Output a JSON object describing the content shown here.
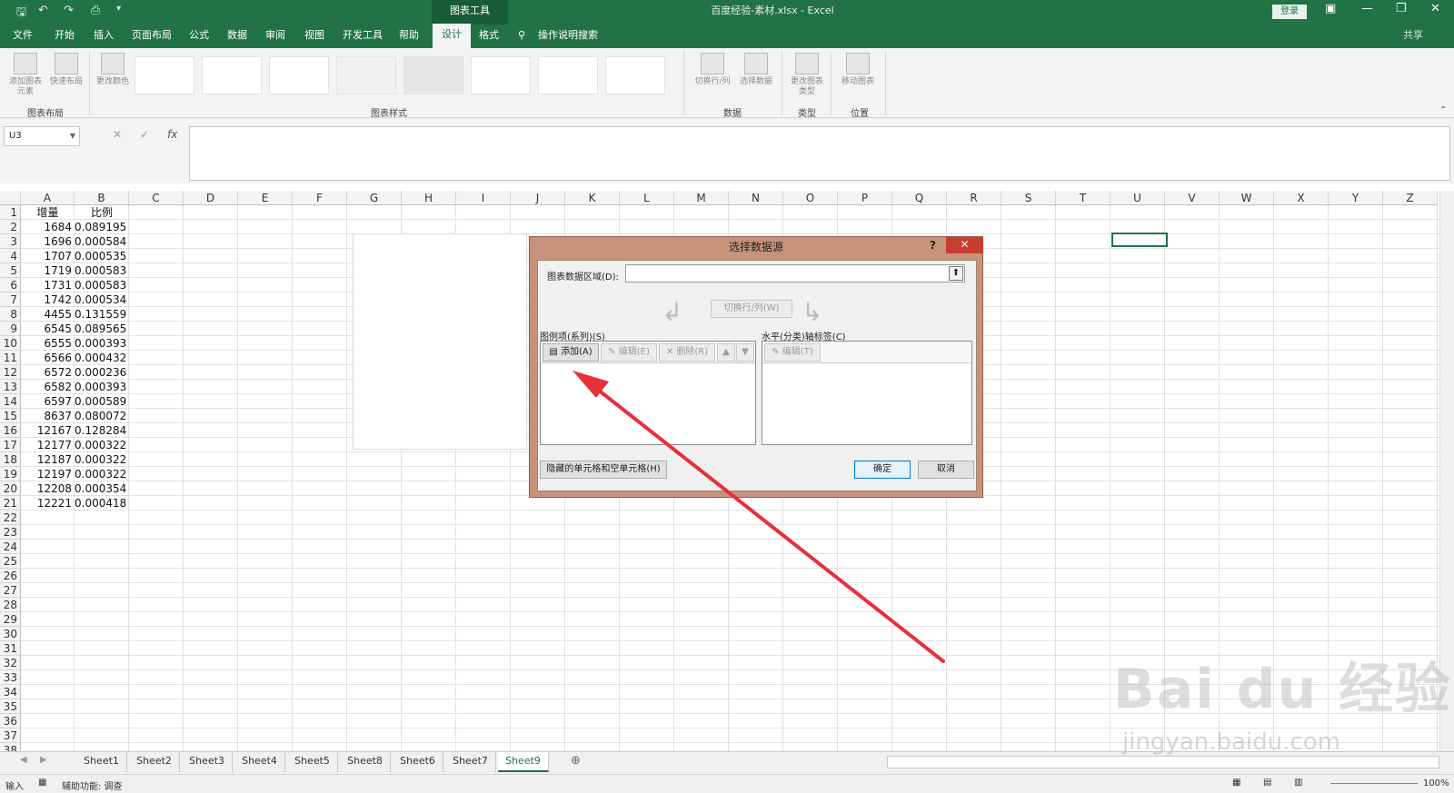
{
  "titlebar": {
    "context_tab": "图表工具",
    "title": "百度经验-素材.xlsx  -  Excel",
    "login": "登录"
  },
  "menu": [
    "文件",
    "开始",
    "插入",
    "页面布局",
    "公式",
    "数据",
    "审阅",
    "视图",
    "开发工具",
    "帮助",
    "设计",
    "格式"
  ],
  "menu_active": "设计",
  "tell_me": "操作说明搜索",
  "share": "共享",
  "ribbon": {
    "add_element": "添加图表元素",
    "quick_layout": "快速布局",
    "change_color": "更改颜色",
    "switch_row_col": "切换行/列",
    "select_data": "选择数据",
    "change_type": "更改图表类型",
    "move_chart": "移动图表",
    "group_layout": "图表布局",
    "group_styles": "图表样式",
    "group_data": "数据",
    "group_type": "类型",
    "group_location": "位置"
  },
  "formula": {
    "namebox": "U3",
    "fx": "fx",
    "cancel": "✕",
    "enter": "✓"
  },
  "columns": [
    "A",
    "B",
    "C",
    "D",
    "E",
    "F",
    "G",
    "H",
    "I",
    "J",
    "K",
    "L",
    "M",
    "N",
    "O",
    "P",
    "Q",
    "R",
    "S",
    "T",
    "U",
    "V",
    "W",
    "X",
    "Y",
    "Z"
  ],
  "headers": {
    "a": "增量",
    "b": "比例"
  },
  "rows": [
    [
      "1684",
      "0.089195"
    ],
    [
      "1696",
      "0.000584"
    ],
    [
      "1707",
      "0.000535"
    ],
    [
      "1719",
      "0.000583"
    ],
    [
      "1731",
      "0.000583"
    ],
    [
      "1742",
      "0.000534"
    ],
    [
      "4455",
      "0.131559"
    ],
    [
      "6545",
      "0.089565"
    ],
    [
      "6555",
      "0.000393"
    ],
    [
      "6566",
      "0.000432"
    ],
    [
      "6572",
      "0.000236"
    ],
    [
      "6582",
      "0.000393"
    ],
    [
      "6597",
      "0.000589"
    ],
    [
      "8637",
      "0.080072"
    ],
    [
      "12167",
      "0.128284"
    ],
    [
      "12177",
      "0.000322"
    ],
    [
      "12187",
      "0.000322"
    ],
    [
      "12197",
      "0.000322"
    ],
    [
      "12208",
      "0.000354"
    ],
    [
      "12221",
      "0.000418"
    ]
  ],
  "row_numbers": [
    "1",
    "2",
    "3",
    "4",
    "5",
    "6",
    "7",
    "8",
    "9",
    "10",
    "11",
    "12",
    "13",
    "14",
    "15",
    "16",
    "17",
    "18",
    "19",
    "20",
    "21",
    "22",
    "23",
    "24",
    "25",
    "26",
    "27",
    "28",
    "29",
    "30",
    "31",
    "32",
    "33",
    "34",
    "35",
    "36",
    "37",
    "38"
  ],
  "sheets": [
    "Sheet1",
    "Sheet2",
    "Sheet3",
    "Sheet4",
    "Sheet5",
    "Sheet8",
    "Sheet6",
    "Sheet7",
    "Sheet9"
  ],
  "active_sheet": "Sheet9",
  "status": {
    "mode": "输入",
    "accessibility": "辅助功能: 调查",
    "zoom": "100%"
  },
  "dialog": {
    "title": "选择数据源",
    "help": "?",
    "range_label": "图表数据区域(D):",
    "switch_button": "切换行/列(W)",
    "legend_label": "图例项(系列)(S)",
    "add_button": "添加(A)",
    "edit_button": "编辑(E)",
    "remove_button": "删除(R)",
    "axis_label": "水平(分类)轴标签(C)",
    "axis_edit_button": "编辑(T)",
    "hidden_cells_button": "隐藏的单元格和空单元格(H)",
    "ok_button": "确定",
    "cancel_button": "取消"
  },
  "watermark": {
    "main": "Bai du 经验",
    "sub": "jingyan.baidu.com"
  },
  "colors": {
    "excel_green": "#217346",
    "dialog_border": "#c7937a",
    "arrow_red": "#e8303a"
  }
}
